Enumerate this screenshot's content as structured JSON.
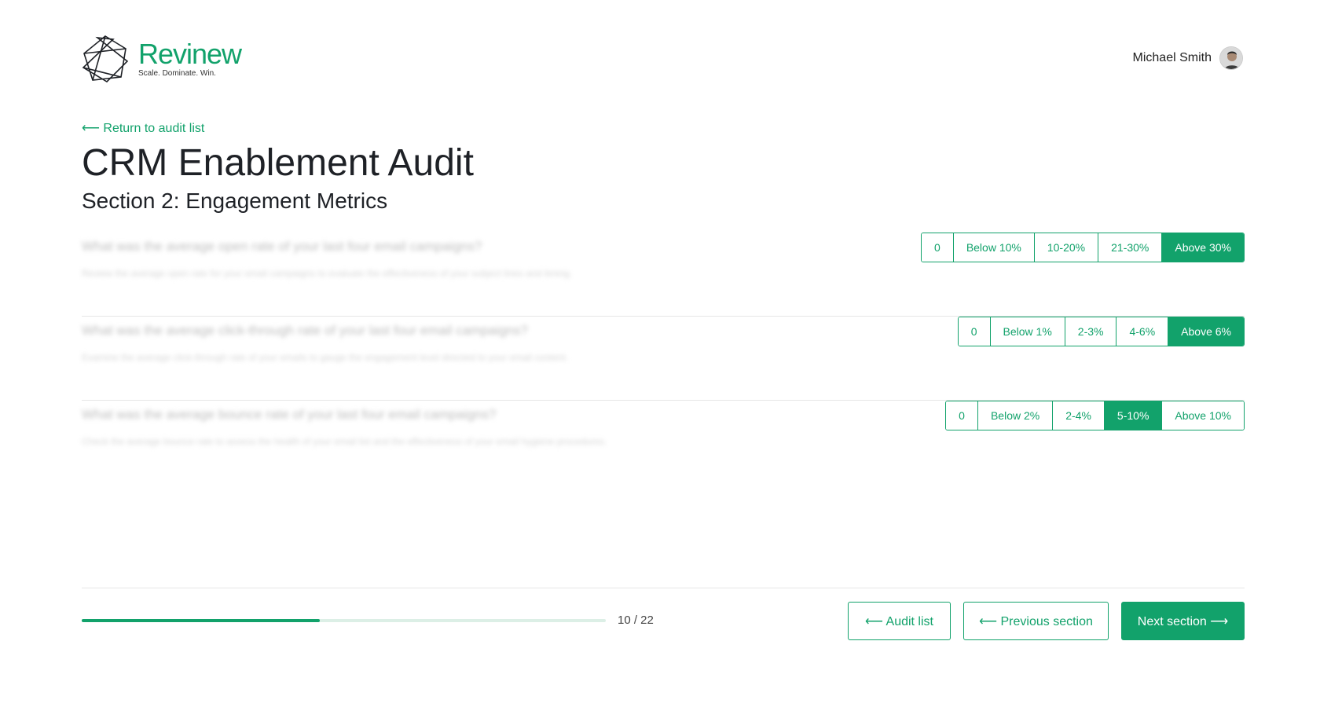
{
  "header": {
    "brand": "Revinew",
    "tagline": "Scale. Dominate. Win.",
    "user_name": "Michael Smith",
    "logo_icon": "network-star-icon",
    "accent_color": "#12a26b"
  },
  "nav": {
    "return_link": "⟵ Return to audit list"
  },
  "page": {
    "title": "CRM Enablement Audit",
    "subtitle": "Section 2: Engagement Metrics"
  },
  "questions": [
    {
      "title": "What was the average open rate of your last four email campaigns?",
      "description": "Review the average open rate for your email campaigns to evaluate the effectiveness of your subject lines and timing.",
      "options": [
        "0",
        "Below 10%",
        "10-20%",
        "21-30%",
        "Above 30%"
      ],
      "selected": "Above 30%"
    },
    {
      "title": "What was the average click-through rate of your last four email campaigns?",
      "description": "Examine the average click-through rate of your emails to gauge the engagement level directed to your email content.",
      "options": [
        "0",
        "Below 1%",
        "2-3%",
        "4-6%",
        "Above 6%"
      ],
      "selected": "Above 6%"
    },
    {
      "title": "What was the average bounce rate of your last four email campaigns?",
      "description": "Check the average bounce rate to assess the health of your email list and the effectiveness of your email hygiene procedures.",
      "options": [
        "0",
        "Below 2%",
        "2-4%",
        "5-10%",
        "Above 10%"
      ],
      "selected": "5-10%"
    }
  ],
  "footer": {
    "progress_current": 10,
    "progress_total": 22,
    "progress_label": "10 / 22",
    "audit_list_button": "⟵ Audit list",
    "previous_button": "⟵ Previous section",
    "next_button": "Next section ⟶"
  }
}
